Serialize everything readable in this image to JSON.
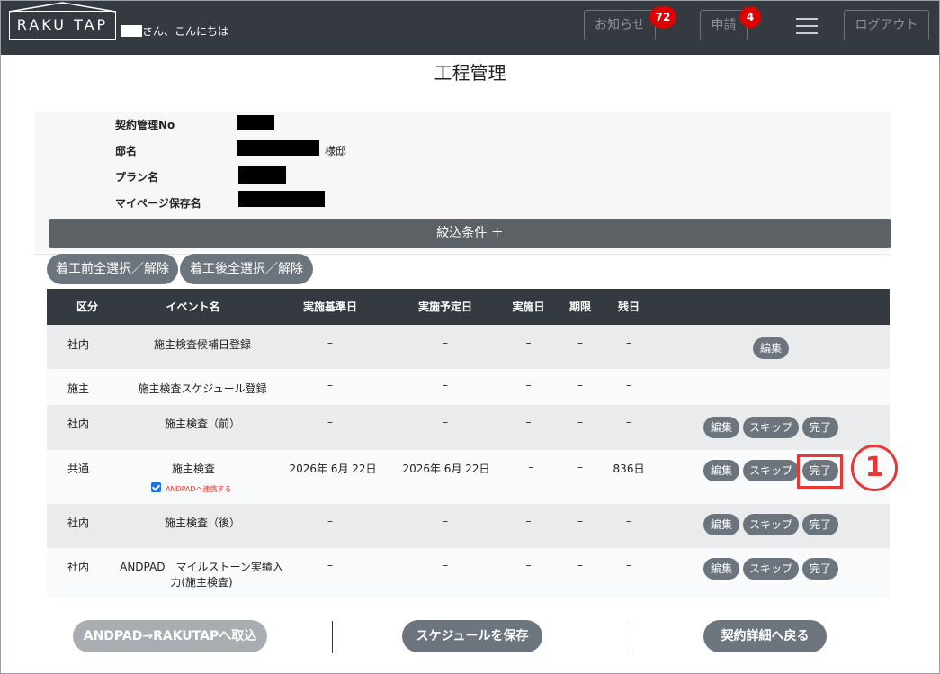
{
  "header": {
    "logo": "RAKU TAP",
    "greeting": "さん、こんにちは",
    "notices_label": "お知らせ",
    "notices_count": "72",
    "requests_label": "申請",
    "requests_count": "4",
    "logout_label": "ログアウト"
  },
  "page_title": "工程管理",
  "info": {
    "contract_no_label": "契約管理No",
    "residence_label": "邸名",
    "residence_suffix": "様邸",
    "plan_label": "プラン名",
    "mypage_label": "マイページ保存名"
  },
  "filter_label": "絞込条件 ＋",
  "select_before_label": "着工前全選択／解除",
  "select_after_label": "着工後全選択／解除",
  "table": {
    "headers": [
      "区分",
      "イベント名",
      "実施基準日",
      "実施予定日",
      "実施日",
      "期限",
      "残日"
    ],
    "rows": [
      {
        "category": "社内",
        "event": "施主検査候補日登録",
        "base_date": "–",
        "planned_date": "–",
        "done_date": "–",
        "deadline": "–",
        "remaining": "–",
        "actions": [
          "編集"
        ]
      },
      {
        "category": "施主",
        "event": "施主検査スケジュール登録",
        "base_date": "–",
        "planned_date": "–",
        "done_date": "–",
        "deadline": "–",
        "remaining": "–",
        "actions": []
      },
      {
        "category": "社内",
        "event": "施主検査（前）",
        "base_date": "–",
        "planned_date": "–",
        "done_date": "–",
        "deadline": "–",
        "remaining": "–",
        "actions": [
          "編集",
          "スキップ",
          "完了"
        ]
      },
      {
        "category": "共通",
        "event": "施主検査",
        "base_date": "2026年 6月 22日",
        "planned_date": "2026年 6月 22日",
        "done_date": "–",
        "deadline": "–",
        "remaining": "836日",
        "checkbox_label": "ANDPADへ連携する",
        "actions": [
          "編集",
          "スキップ",
          "完了"
        ]
      },
      {
        "category": "社内",
        "event": "施主検査（後）",
        "base_date": "–",
        "planned_date": "–",
        "done_date": "–",
        "deadline": "–",
        "remaining": "–",
        "actions": [
          "編集",
          "スキップ",
          "完了"
        ]
      },
      {
        "category": "社内",
        "event_line1": "ANDPAD　マイルストーン実績入",
        "event_line2": "力(施主検査)",
        "base_date": "–",
        "planned_date": "–",
        "done_date": "–",
        "deadline": "–",
        "remaining": "–",
        "actions": [
          "編集",
          "スキップ",
          "完了"
        ]
      }
    ]
  },
  "annotation_number": "1",
  "footer": {
    "import_label": "ANDPAD→RAKUTAPへ取込",
    "save_label": "スケジュールを保存",
    "back_label": "契約詳細へ戻る"
  }
}
